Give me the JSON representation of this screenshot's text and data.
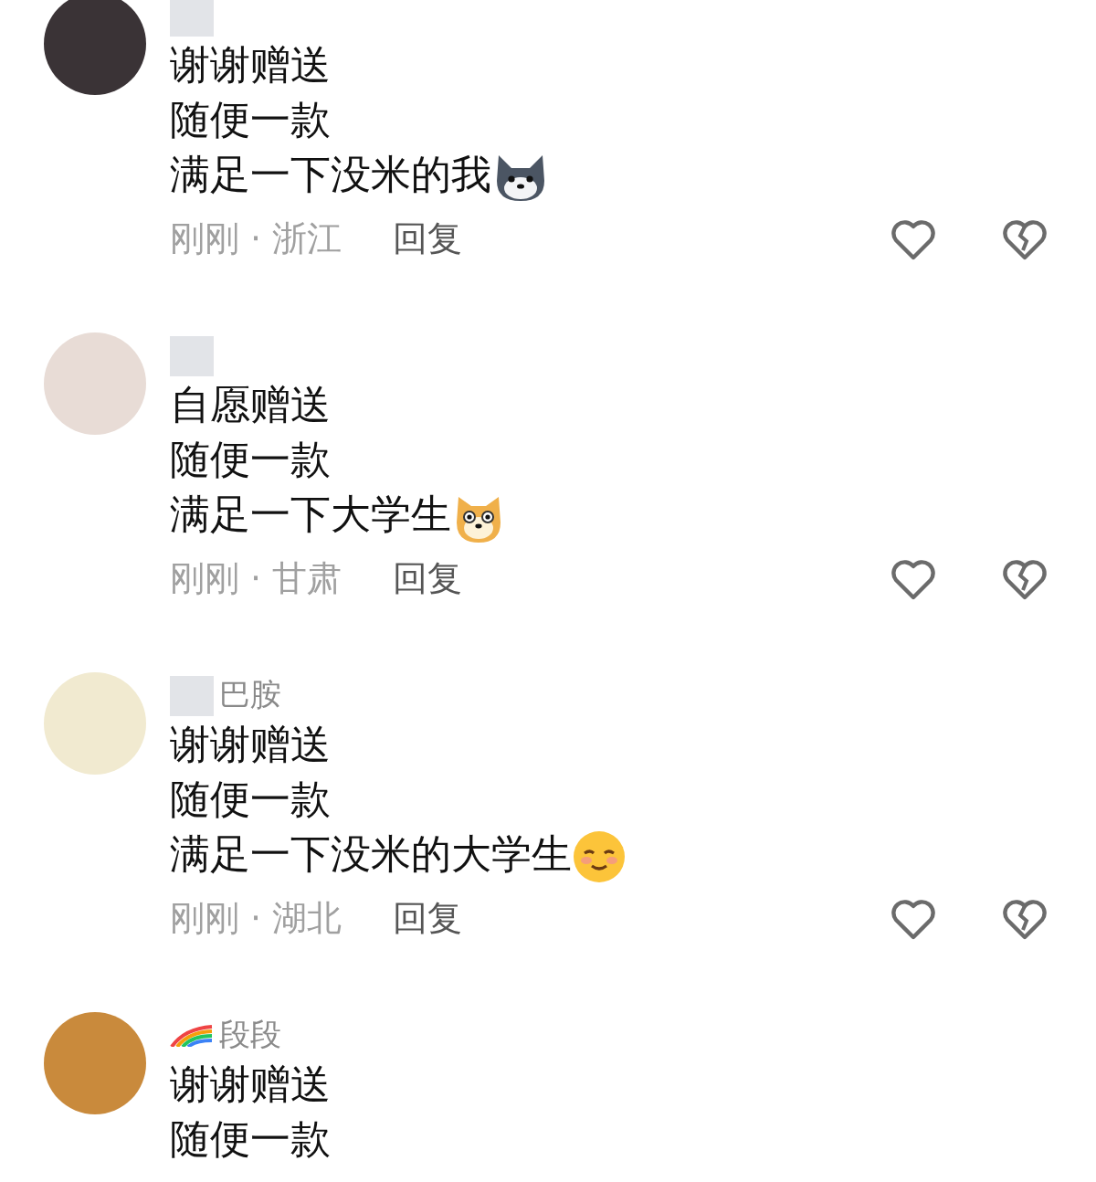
{
  "comments": [
    {
      "name_redacted": true,
      "lines": [
        "谢谢赠送",
        "随便一款",
        "满足一下没米的我"
      ],
      "meta": "刚刚 · 浙江",
      "reply": "回复"
    },
    {
      "name_redacted": true,
      "lines": [
        "自愿赠送",
        "随便一款",
        "满足一下大学生"
      ],
      "meta": "刚刚 · 甘肃",
      "reply": "回复"
    },
    {
      "name_redacted": true,
      "username": "巴胺",
      "lines": [
        "谢谢赠送",
        "随便一款",
        "满足一下没米的大学生"
      ],
      "meta": "刚刚 · 湖北",
      "reply": "回复"
    },
    {
      "name_redacted": false,
      "badge": true,
      "username": "段段",
      "lines": [
        "谢谢赠送",
        "随便一款"
      ]
    }
  ]
}
